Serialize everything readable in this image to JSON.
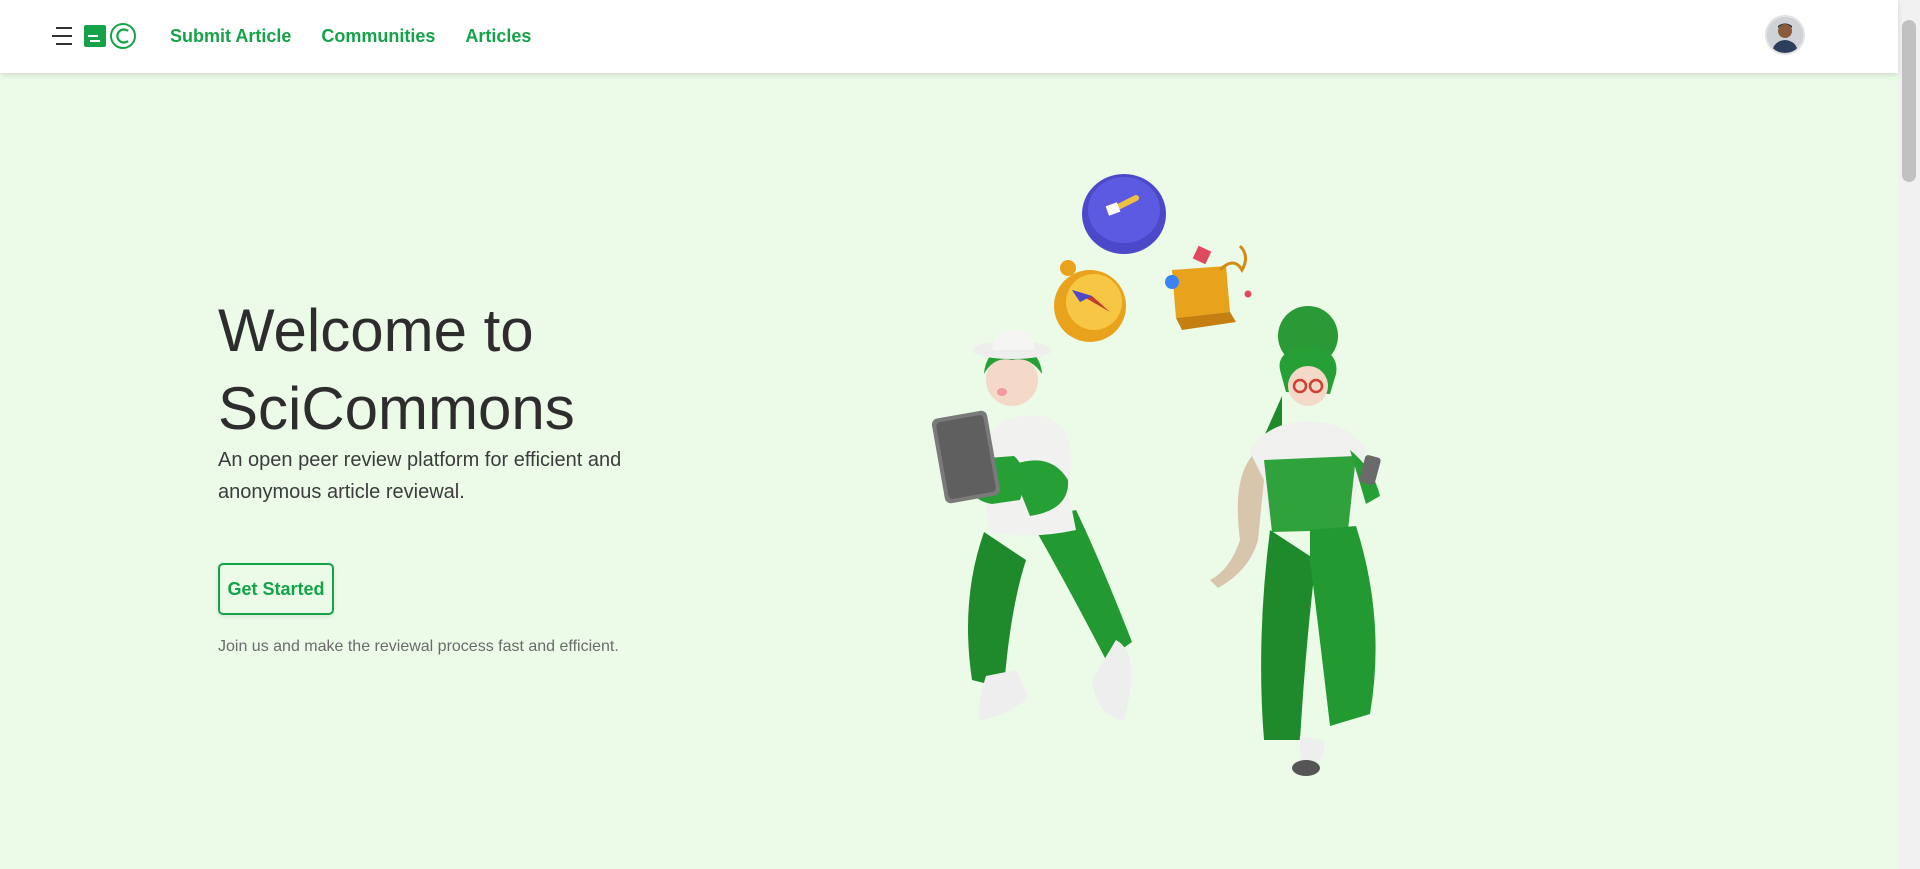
{
  "nav": {
    "links": [
      "Submit Article",
      "Communities",
      "Articles"
    ]
  },
  "hero": {
    "title_line1": "Welcome to",
    "title_line2": "SciCommons",
    "subtitle": "An open peer review platform for efficient and anonymous article reviewal.",
    "cta_label": "Get Started",
    "tagline": "Join us and make the reviewal process fast and efficient."
  },
  "colors": {
    "accent": "#15a34a",
    "background": "#ebfbe8",
    "navbar": "#ffffff"
  },
  "icons": [
    "menu-icon",
    "logo-icon",
    "avatar",
    "illustration"
  ]
}
